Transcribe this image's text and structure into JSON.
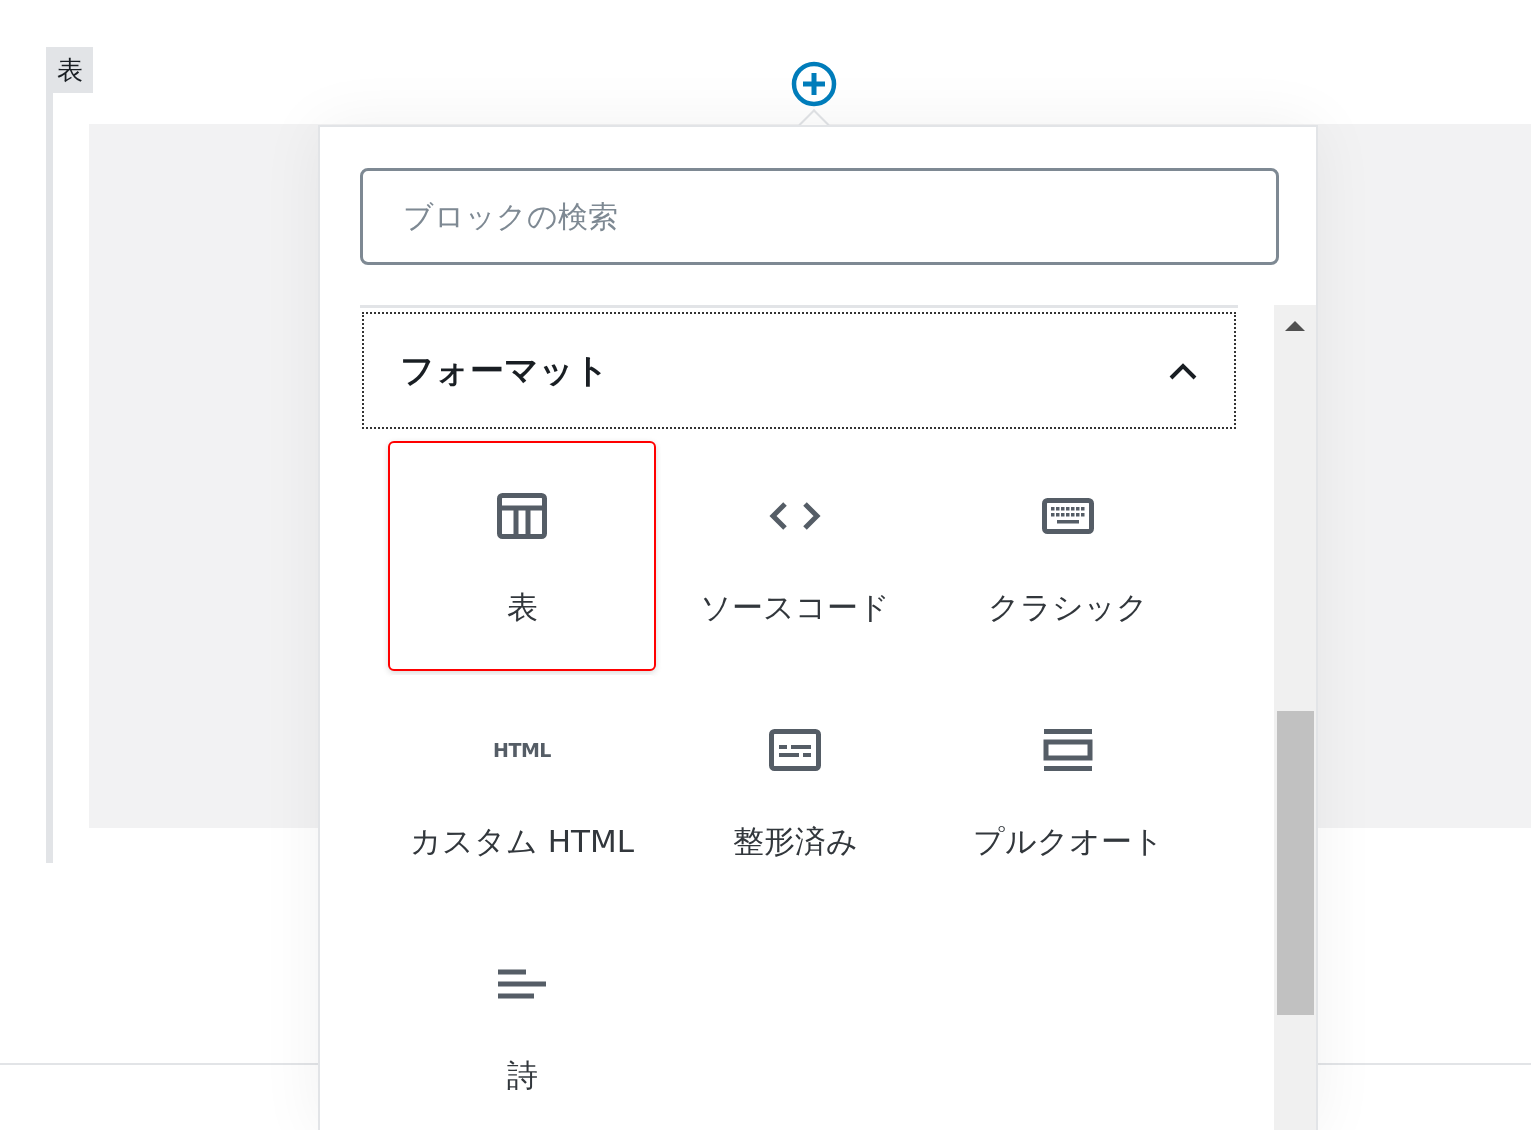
{
  "block_label": "表",
  "inserter": {
    "search": {
      "placeholder": "ブロックの検索"
    },
    "panel": {
      "title": "フォーマット",
      "expanded": true,
      "items": [
        {
          "label": "表",
          "kind": "table",
          "selected": true
        },
        {
          "label": "ソースコード",
          "kind": "code",
          "selected": false
        },
        {
          "label": "クラシック",
          "kind": "keyboard",
          "selected": false
        },
        {
          "label": "カスタム HTML",
          "kind": "html",
          "icon_text": "HTML",
          "selected": false
        },
        {
          "label": "整形済み",
          "kind": "preformatted",
          "selected": false
        },
        {
          "label": "プルクオート",
          "kind": "pullquote",
          "selected": false
        },
        {
          "label": "詩",
          "kind": "verse",
          "selected": false
        }
      ]
    }
  }
}
